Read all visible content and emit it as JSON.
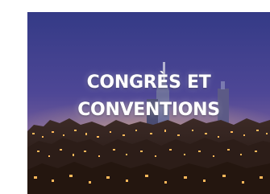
{
  "card": {
    "title_line1": "CONGRÈS ET",
    "title_line2": "CONVENTIONS",
    "image_subject": "lyon-skyline-at-dusk",
    "colors": {
      "sky_top": "#3a3f8c",
      "sky_mid": "#5a4c9a",
      "horizon_glow": "#c48a6a",
      "city_dark": "#2a1c18",
      "lights": "#ffb85a",
      "caption": "#ffffff"
    }
  }
}
